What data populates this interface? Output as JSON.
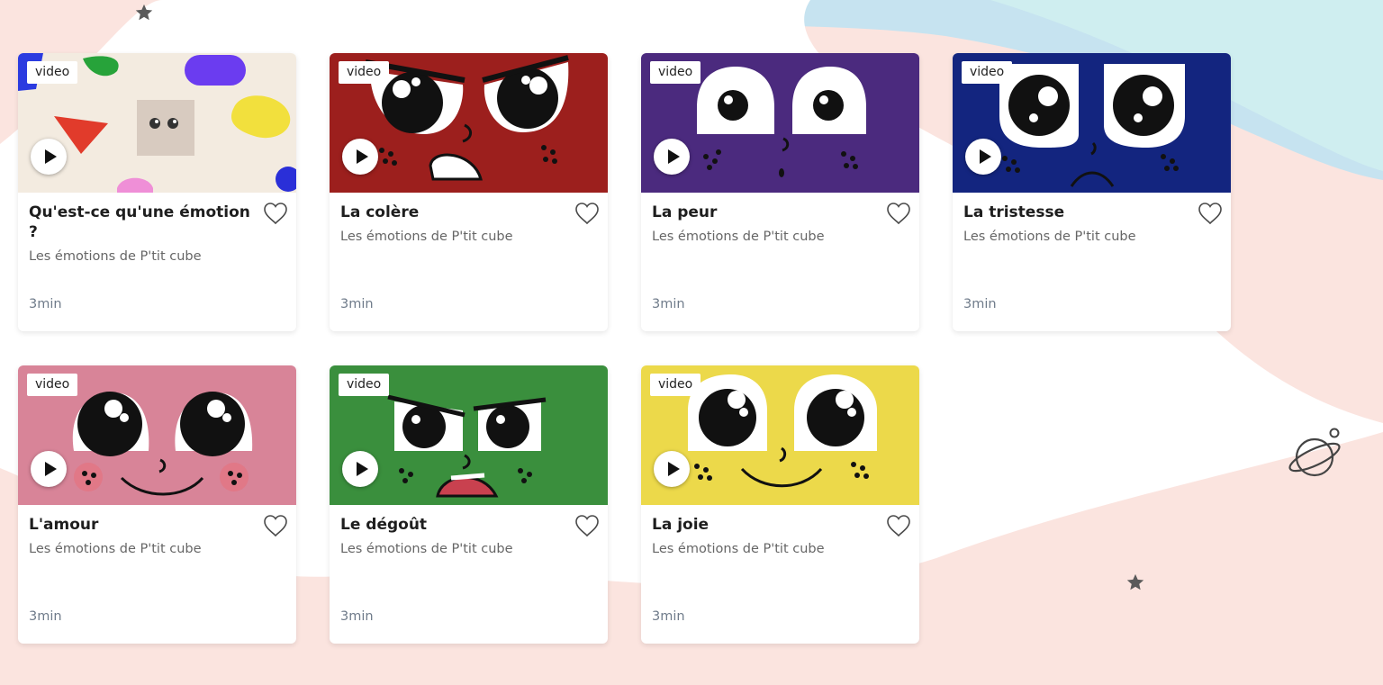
{
  "colors": {
    "page_bg": "#fbe4df",
    "wave_blue": "#c7e4ef",
    "wave_white": "#ffffff",
    "star": "#5a5a5a"
  },
  "cards": [
    {
      "tag": "video",
      "title": "Qu'est-ce qu'une émotion ?",
      "subtitle": "Les émotions de P'tit cube",
      "duration": "3min",
      "theme": "shapes",
      "thumb_color": "#f3ebe0"
    },
    {
      "tag": "video",
      "title": "La colère",
      "subtitle": "Les émotions de P'tit cube",
      "duration": "3min",
      "theme": "angry",
      "thumb_color": "#9c1f1d"
    },
    {
      "tag": "video",
      "title": "La peur",
      "subtitle": "Les émotions de P'tit cube",
      "duration": "3min",
      "theme": "fear",
      "thumb_color": "#4b2a7e"
    },
    {
      "tag": "video",
      "title": "La tristesse",
      "subtitle": "Les émotions de P'tit cube",
      "duration": "3min",
      "theme": "sad",
      "thumb_color": "#13257f"
    },
    {
      "tag": "video",
      "title": "L'amour",
      "subtitle": "Les émotions de P'tit cube",
      "duration": "3min",
      "theme": "love",
      "thumb_color": "#d88498"
    },
    {
      "tag": "video",
      "title": "Le dégoût",
      "subtitle": "Les émotions de P'tit cube",
      "duration": "3min",
      "theme": "disgust",
      "thumb_color": "#3a8f3d"
    },
    {
      "tag": "video",
      "title": "La joie",
      "subtitle": "Les émotions de P'tit cube",
      "duration": "3min",
      "theme": "joy",
      "thumb_color": "#ecd94a"
    }
  ],
  "icons": {
    "tag": "video-tag",
    "play": "play-icon",
    "favorite": "heart-outline-icon",
    "decor": [
      "star-icon",
      "star-icon",
      "planet-icon"
    ]
  }
}
